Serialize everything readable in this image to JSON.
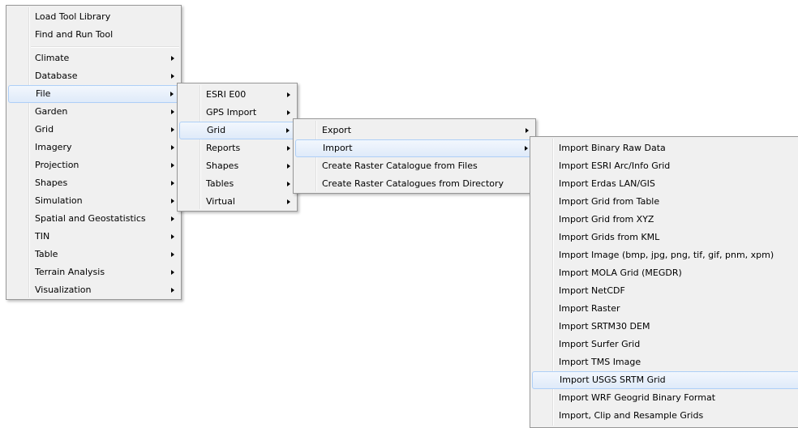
{
  "menu1": {
    "top_items": [
      "Load Tool Library",
      "Find and Run Tool"
    ],
    "items": [
      "Climate",
      "Database",
      "File",
      "Garden",
      "Grid",
      "Imagery",
      "Projection",
      "Shapes",
      "Simulation",
      "Spatial and Geostatistics",
      "TIN",
      "Table",
      "Terrain Analysis",
      "Visualization"
    ],
    "highlighted": "File"
  },
  "menu2": {
    "items": [
      "ESRI E00",
      "GPS Import",
      "Grid",
      "Reports",
      "Shapes",
      "Tables",
      "Virtual"
    ],
    "highlighted": "Grid"
  },
  "menu3": {
    "items": [
      "Export",
      "Import",
      "Create Raster Catalogue from Files",
      "Create Raster Catalogues from Directory"
    ],
    "highlighted": "Import"
  },
  "menu4": {
    "items": [
      "Import Binary Raw Data",
      "Import ESRI Arc/Info Grid",
      "Import Erdas LAN/GIS",
      "Import Grid from Table",
      "Import Grid from XYZ",
      "Import Grids from KML",
      "Import Image (bmp, jpg, png, tif, gif, pnm, xpm)",
      "Import MOLA Grid (MEGDR)",
      "Import NetCDF",
      "Import Raster",
      "Import SRTM30 DEM",
      "Import Surfer Grid",
      "Import TMS Image",
      "Import USGS SRTM Grid",
      "Import WRF Geogrid Binary Format",
      "Import, Clip and Resample Grids"
    ],
    "highlighted": "Import USGS SRTM Grid"
  }
}
